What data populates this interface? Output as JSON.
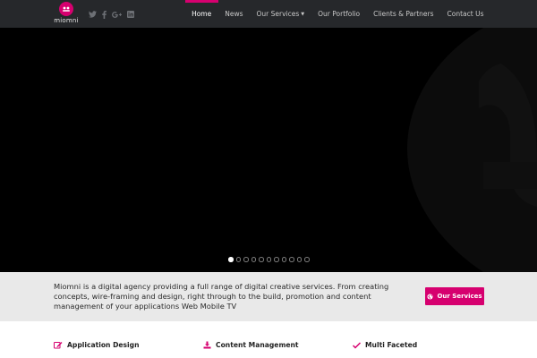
{
  "header": {
    "logo_text": "miomni",
    "social_icons": [
      "twitter-icon",
      "facebook-icon",
      "google-plus-icon",
      "linkedin-icon"
    ],
    "nav": [
      {
        "label": "Home",
        "active": true
      },
      {
        "label": "News"
      },
      {
        "label": "Our Services",
        "has_dropdown": true
      },
      {
        "label": "Our Portfolio"
      },
      {
        "label": "Clients & Partners"
      },
      {
        "label": "Contact Us"
      }
    ]
  },
  "hero": {
    "slide_count": 11,
    "active_slide": 1
  },
  "intro": {
    "text": "Miomni is a digital agency providing a full range of digital creative services. From creating concepts, wire-framing and design, right through to the build, promotion and content management of your applications Web Mobile TV",
    "cta_label": "Our Services",
    "cta_icon": "globe-icon"
  },
  "features": [
    {
      "icon": "edit-icon",
      "label": "Application Design"
    },
    {
      "icon": "download-icon",
      "label": "Content Management"
    },
    {
      "icon": "check-icon",
      "label": "Multi Faceted"
    }
  ],
  "colors": {
    "accent": "#d6006f",
    "header_bg": "#26282b",
    "band_bg": "#e9e9e9"
  }
}
